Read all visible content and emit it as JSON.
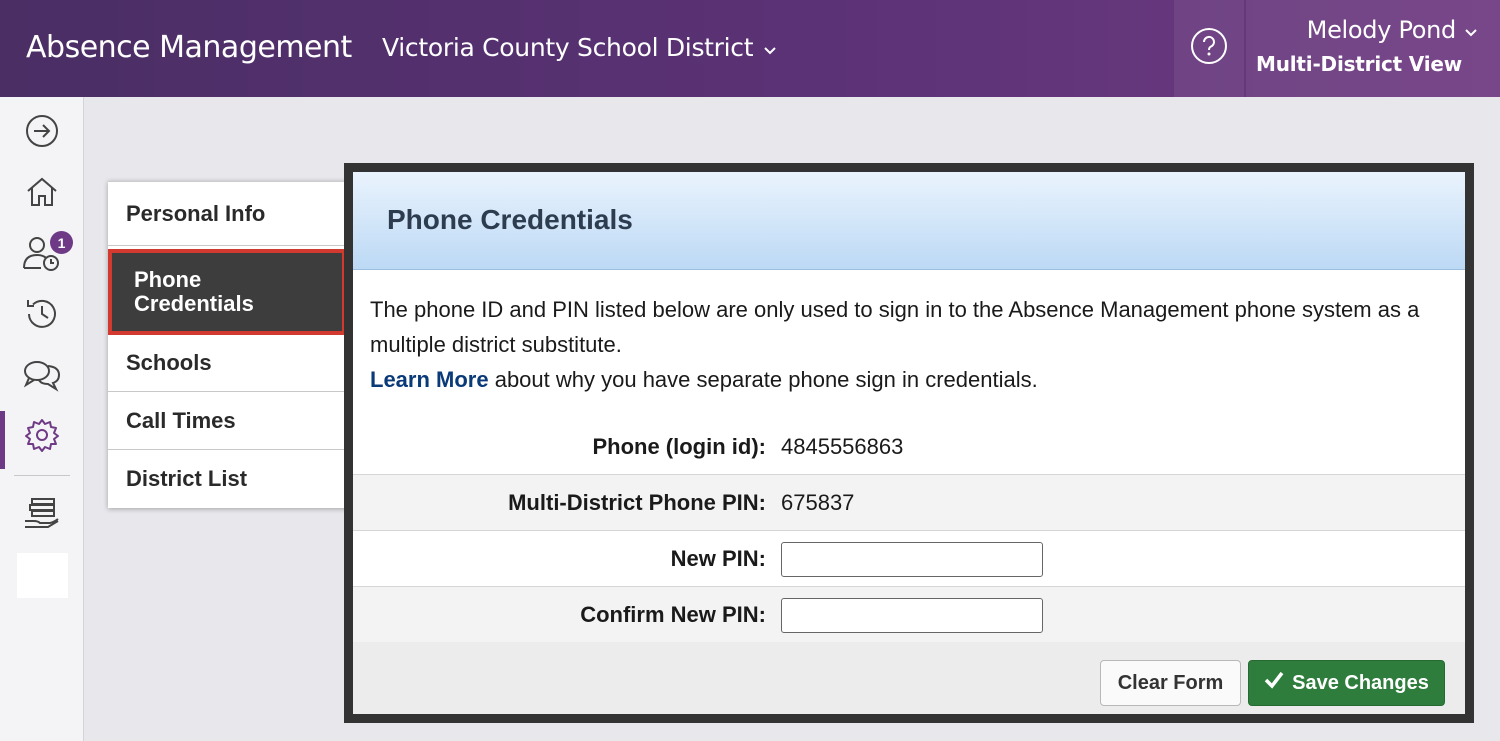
{
  "header": {
    "app_title": "Absence Management",
    "district": "Victoria County School District",
    "user_name": "Melody Pond",
    "user_view": "Multi-District View"
  },
  "rail": {
    "badge_count": "1",
    "icons": [
      "arrow-right-circle-icon",
      "home-icon",
      "user-clock-icon",
      "history-icon",
      "chat-icon",
      "gear-icon",
      "hand-stack-icon"
    ],
    "active": "gear-icon"
  },
  "side_menu": {
    "items": [
      {
        "label": "Personal Info"
      },
      {
        "label": "Phone Credentials"
      },
      {
        "label": "Schools"
      },
      {
        "label": "Call Times"
      },
      {
        "label": "District List"
      }
    ],
    "selected": "Phone Credentials"
  },
  "dialog": {
    "title": "Phone Credentials",
    "description": "The phone ID and PIN listed below are only used to sign in to the Absence Management phone system as a multiple district substitute.",
    "learn_more": "Learn More",
    "learn_more_suffix": " about why you have separate phone sign in credentials.",
    "fields": {
      "phone_label": "Phone (login id):",
      "phone_value": "4845556863",
      "pin_label": "Multi-District Phone PIN:",
      "pin_value": "675837",
      "new_pin_label": "New PIN:",
      "new_pin_value": "",
      "confirm_pin_label": "Confirm New PIN:",
      "confirm_pin_value": ""
    },
    "buttons": {
      "clear": "Clear Form",
      "save": "Save Changes"
    }
  },
  "colors": {
    "header_bg": "#5c3276",
    "accent_purple": "#6e3a86",
    "selected_outline": "#d33a2f",
    "save_green": "#2e7d3c",
    "link_blue": "#0b3a78"
  }
}
